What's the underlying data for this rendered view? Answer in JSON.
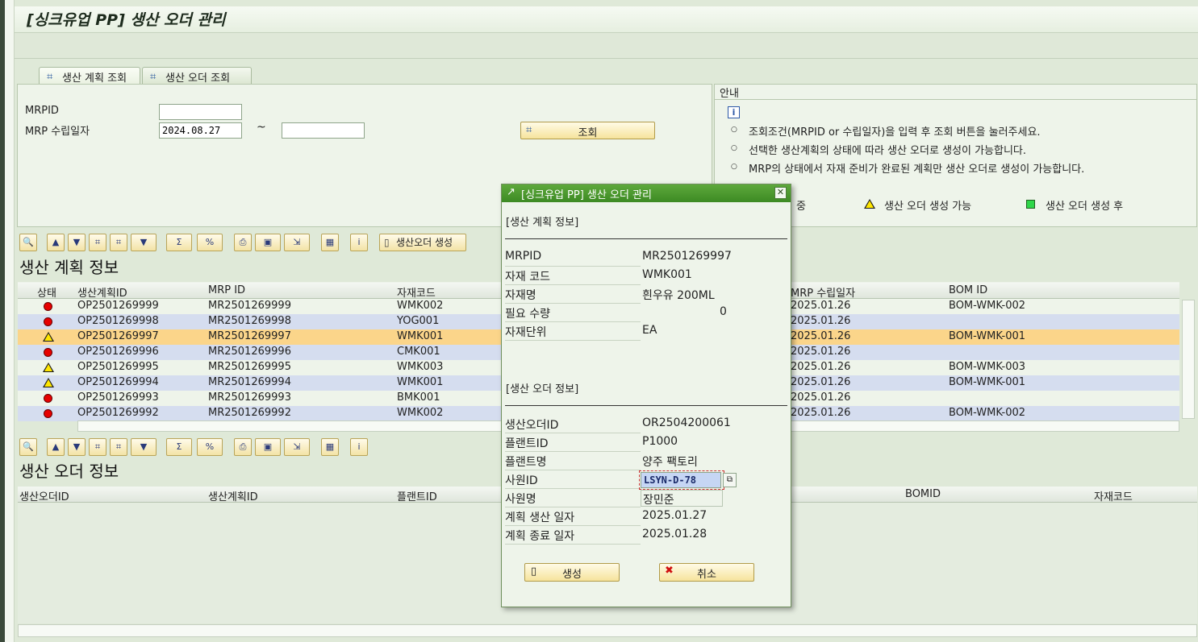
{
  "window": {
    "title": "[싱크유업 PP] 생산 오더 관리"
  },
  "tabs": [
    {
      "label": "생산 계획 조회",
      "active": true
    },
    {
      "label": "생산 오더 조회",
      "active": false
    }
  ],
  "search": {
    "mrpid_label": "MRPID",
    "mrpid_value": "",
    "date_label": "MRP 수립일자",
    "date_from": "2024.08.27",
    "tilde": "~",
    "date_to": "",
    "query_button": "조회"
  },
  "guide": {
    "title": "안내",
    "lines": [
      "조회조건(MRPID or 수립일자)을 입력 후 조회 버튼을 눌러주세요.",
      "선택한 생산계획의 상태에 따라 생산 오더로 생성이 가능합니다.",
      "MRP의 상태에서 자재 준비가 완료된 계획만 생산 오더로 생성이 가능합니다."
    ],
    "legend": [
      "준비 중",
      "생산 오더 생성 가능",
      "생산 오더 생성 후"
    ],
    "legend_visible_first": "중"
  },
  "toolbar": {
    "create_order_label": "생산오더 생성"
  },
  "plan_section": {
    "title": "생산 계획 정보",
    "columns": [
      "상태",
      "생산계획ID",
      "MRP ID",
      "자재코드",
      "MRP 수립일자",
      "BOM ID"
    ],
    "rows": [
      {
        "status": "red",
        "plan_id": "OP2501269999",
        "mrp_id": "MR2501269999",
        "material": "WMK002",
        "mrp_date": "2025.01.26",
        "bom": "BOM-WMK-002"
      },
      {
        "status": "red",
        "plan_id": "OP2501269998",
        "mrp_id": "MR2501269998",
        "material": "YOG001",
        "mrp_date": "2025.01.26",
        "bom": ""
      },
      {
        "status": "yellow",
        "plan_id": "OP2501269997",
        "mrp_id": "MR2501269997",
        "material": "WMK001",
        "mrp_date": "2025.01.26",
        "bom": "BOM-WMK-001"
      },
      {
        "status": "red",
        "plan_id": "OP2501269996",
        "mrp_id": "MR2501269996",
        "material": "CMK001",
        "mrp_date": "2025.01.26",
        "bom": ""
      },
      {
        "status": "yellow",
        "plan_id": "OP2501269995",
        "mrp_id": "MR2501269995",
        "material": "WMK003",
        "mrp_date": "2025.01.26",
        "bom": "BOM-WMK-003"
      },
      {
        "status": "yellow",
        "plan_id": "OP2501269994",
        "mrp_id": "MR2501269994",
        "material": "WMK001",
        "mrp_date": "2025.01.26",
        "bom": "BOM-WMK-001"
      },
      {
        "status": "red",
        "plan_id": "OP2501269993",
        "mrp_id": "MR2501269993",
        "material": "BMK001",
        "mrp_date": "2025.01.26",
        "bom": ""
      },
      {
        "status": "red",
        "plan_id": "OP2501269992",
        "mrp_id": "MR2501269992",
        "material": "WMK002",
        "mrp_date": "2025.01.26",
        "bom": "BOM-WMK-002"
      }
    ]
  },
  "order_section": {
    "title": "생산 오더 정보",
    "columns": [
      "생산오더ID",
      "생산계획ID",
      "플랜트ID",
      "BOMID",
      "자재코드"
    ]
  },
  "dialog": {
    "title": "[싱크유업 PP] 생산 오더 관리",
    "plan_header": "[생산 계획 정보]",
    "plan_fields": [
      {
        "label": "MRPID",
        "value": "MR2501269997"
      },
      {
        "label": "자재 코드",
        "value": "WMK001"
      },
      {
        "label": "자재명",
        "value": "흰우유 200ML"
      },
      {
        "label": "필요 수량",
        "value": "0"
      },
      {
        "label": "자재단위",
        "value": "EA"
      }
    ],
    "order_header": "[생산 오더 정보]",
    "order_fields": [
      {
        "label": "생산오더ID",
        "value": "OR2504200061"
      },
      {
        "label": "플랜트ID",
        "value": "P1000"
      },
      {
        "label": "플랜트명",
        "value": "양주 팩토리"
      },
      {
        "label": "사원ID",
        "value": "LSYN-D-78"
      },
      {
        "label": "사원명",
        "value": "장민준"
      },
      {
        "label": "계획 생산 일자",
        "value": "2025.01.27"
      },
      {
        "label": "계획 종료 일자",
        "value": "2025.01.28"
      }
    ],
    "create_button": "생성",
    "cancel_button": "취소"
  },
  "colors": {
    "selected_row": "#fbd58a",
    "alt_row": "#d5ddef",
    "row": "#eef4ea",
    "dialog_title": "#4a9a2e"
  }
}
